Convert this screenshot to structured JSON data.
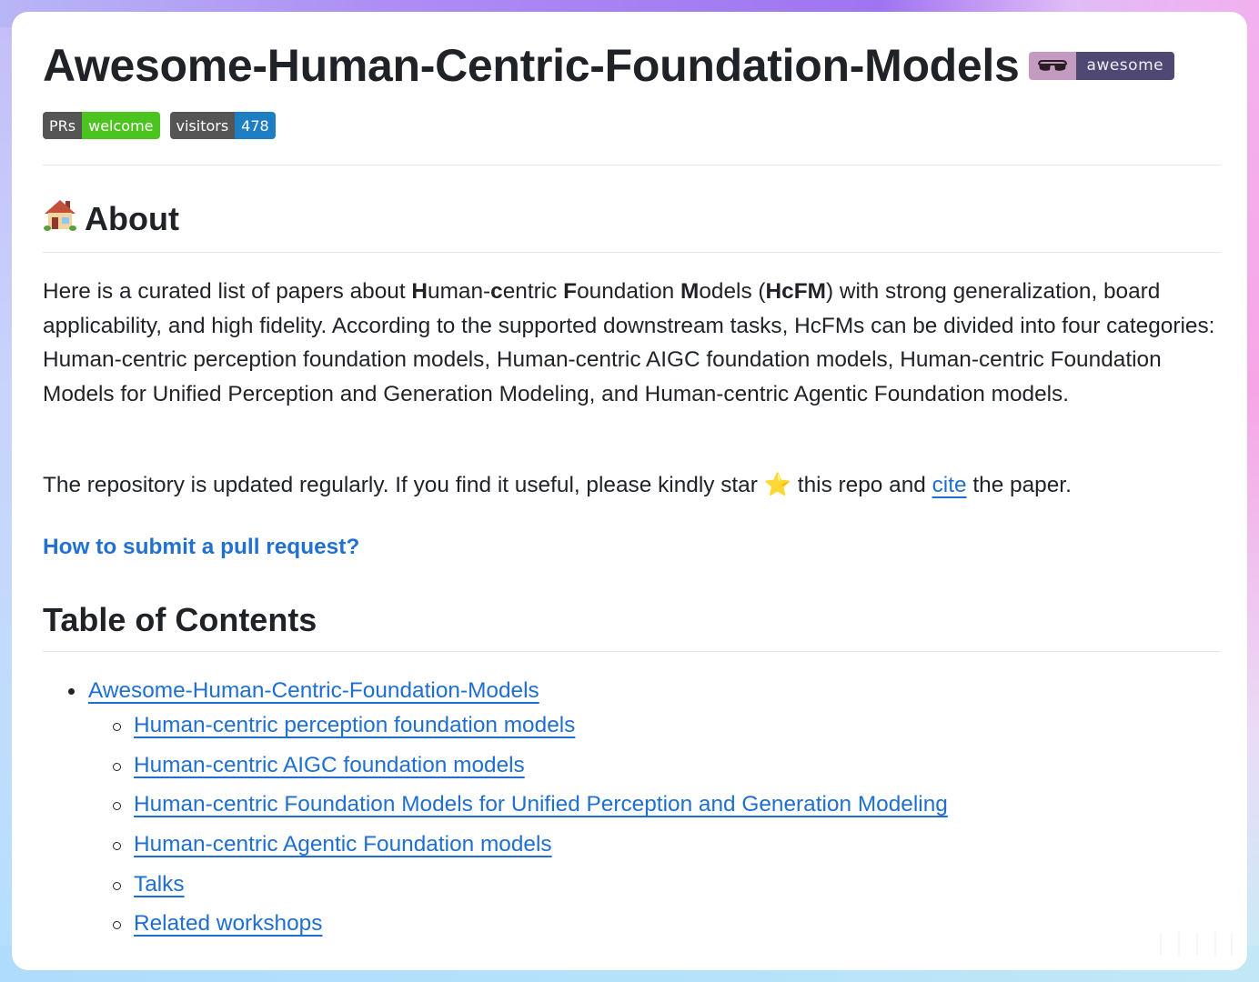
{
  "header": {
    "title": "Awesome-Human-Centric-Foundation-Models",
    "awesome_badge": {
      "icon": "sunglasses-icon",
      "label": "awesome",
      "icon_bg": "#c49bc0",
      "label_bg": "#4e4872"
    }
  },
  "badges": [
    {
      "label": "PRs",
      "value": "welcome",
      "value_color": "#4cc41f"
    },
    {
      "label": "visitors",
      "value": "478",
      "value_color": "#1d7ec4"
    }
  ],
  "about": {
    "icon": "house-emoji-icon",
    "heading": "About",
    "paragraph": {
      "t1": "Here is a curated list of papers about ",
      "b1": "H",
      "t2": "uman-",
      "b2": "c",
      "t3": "entric ",
      "b3": "F",
      "t4": "oundation ",
      "b4": "M",
      "t5": "odels (",
      "b5": "HcFM",
      "t6": ") with strong generalization, board applicability, and high fidelity. According to the supported downstream tasks, HcFMs can be divided into four categories: Human-centric perception foundation models, Human-centric AIGC foundation models, Human-centric Foundation Models for Unified Perception and Generation Modeling, and Human-centric Agentic Foundation models."
    },
    "note": {
      "before": "The repository is updated regularly. If you find it useful, please kindly star ",
      "star": "⭐",
      "middle": " this repo and ",
      "cite_link": "cite",
      "after": " the paper."
    },
    "pr_link": "How to submit a pull request?"
  },
  "toc": {
    "heading": "Table of Contents",
    "root": "Awesome-Human-Centric-Foundation-Models",
    "items": [
      "Human-centric perception foundation models",
      "Human-centric AIGC foundation models",
      "Human-centric Foundation Models for Unified Perception and Generation Modeling",
      "Human-centric Agentic Foundation models",
      "Talks",
      "Related workshops"
    ]
  },
  "colors": {
    "text": "#1f2328",
    "link": "#1f6fd0",
    "divider": "#e3e6ea"
  }
}
